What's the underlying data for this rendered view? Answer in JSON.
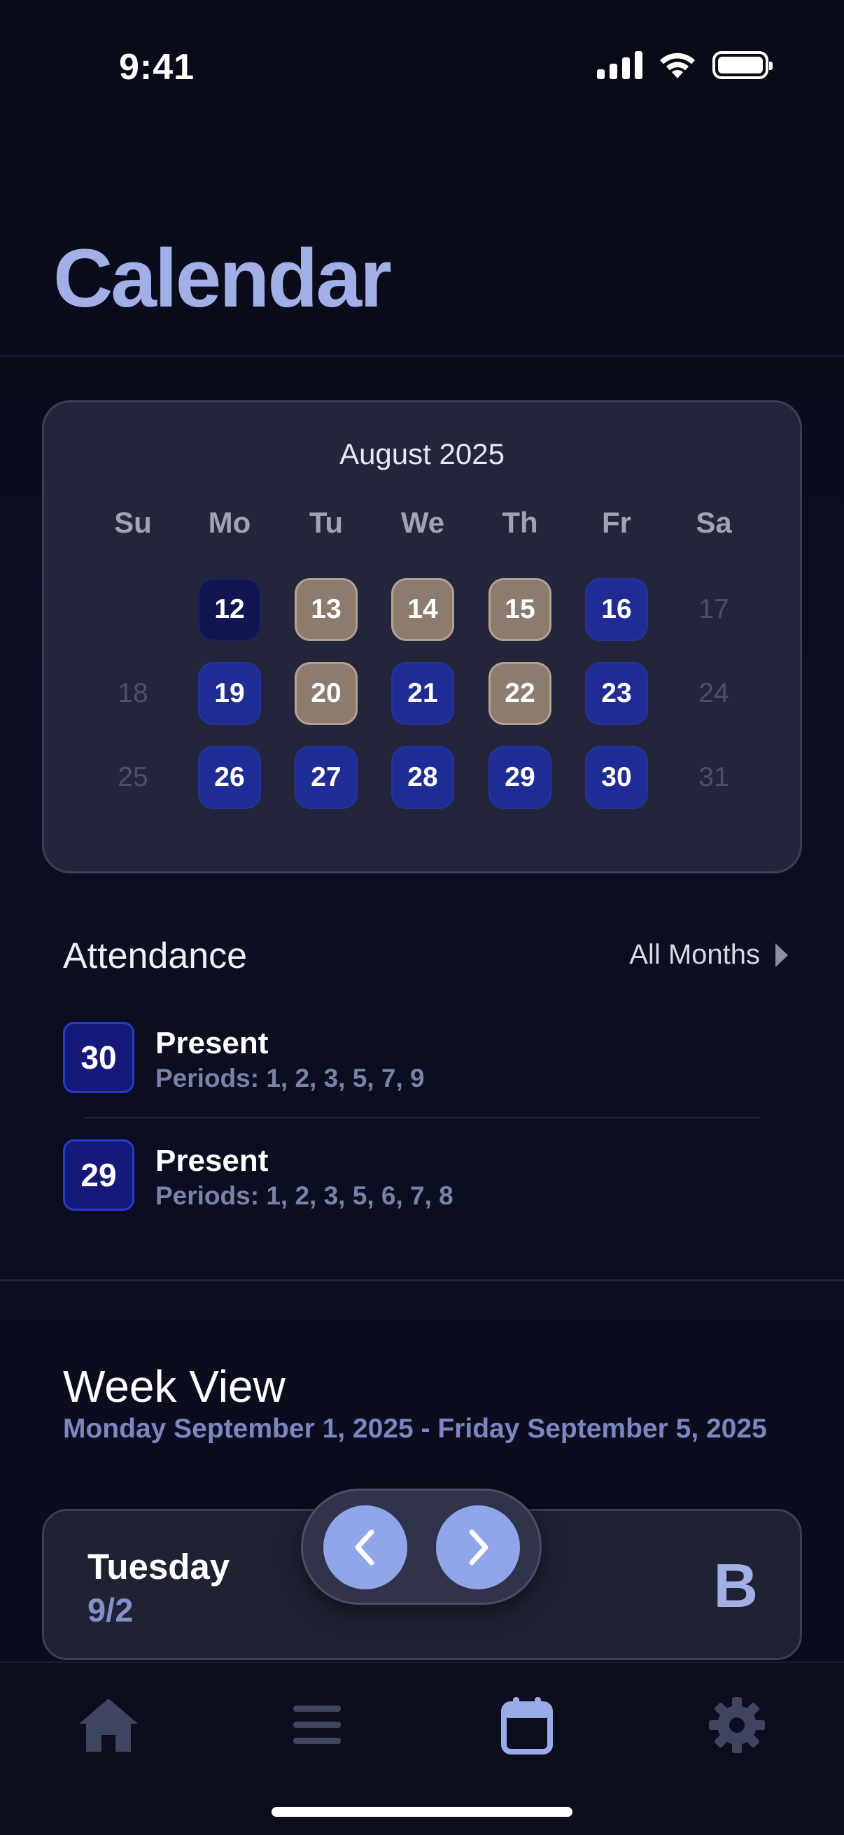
{
  "status_bar": {
    "time": "9:41",
    "icons": [
      "signal-icon",
      "wifi-icon",
      "battery-icon"
    ]
  },
  "page": {
    "title": "Calendar"
  },
  "calendar": {
    "month_label": "August 2025",
    "weekdays": [
      "Su",
      "Mo",
      "Tu",
      "We",
      "Th",
      "Fr",
      "Sa"
    ],
    "weeks": [
      [
        {
          "day": ""
        },
        {
          "day": "12",
          "state": "dark"
        },
        {
          "day": "13",
          "state": "tan"
        },
        {
          "day": "14",
          "state": "tan"
        },
        {
          "day": "15",
          "state": "tan"
        },
        {
          "day": "16",
          "state": "blue"
        },
        {
          "day": "17",
          "state": "muted"
        }
      ],
      [
        {
          "day": "18",
          "state": "muted"
        },
        {
          "day": "19",
          "state": "blue"
        },
        {
          "day": "20",
          "state": "tan"
        },
        {
          "day": "21",
          "state": "blue"
        },
        {
          "day": "22",
          "state": "tan"
        },
        {
          "day": "23",
          "state": "blue"
        },
        {
          "day": "24",
          "state": "muted"
        }
      ],
      [
        {
          "day": "25",
          "state": "muted"
        },
        {
          "day": "26",
          "state": "blue"
        },
        {
          "day": "27",
          "state": "blue"
        },
        {
          "day": "28",
          "state": "blue"
        },
        {
          "day": "29",
          "state": "blue"
        },
        {
          "day": "30",
          "state": "blue"
        },
        {
          "day": "31",
          "state": "muted"
        }
      ]
    ],
    "colors": {
      "dark": "#121650",
      "blue": "#1f2c96",
      "tan": "#8d7b6e",
      "muted": "#4c5066"
    }
  },
  "attendance": {
    "title": "Attendance",
    "all_months_label": "All Months",
    "records": [
      {
        "date": "30",
        "status": "Present",
        "periods": "Periods: 1, 2, 3, 5, 7, 9"
      },
      {
        "date": "29",
        "status": "Present",
        "periods": "Periods: 1, 2, 3, 5, 6, 7, 8"
      }
    ]
  },
  "week_view": {
    "title": "Week View",
    "range": "Monday September 1, 2025 - Friday September 5, 2025",
    "day": {
      "name": "Tuesday",
      "date": "9/2",
      "letter": "B"
    },
    "nav": {
      "prev_icon": "chevron-left-icon",
      "next_icon": "chevron-right-icon"
    }
  },
  "tab_bar": {
    "tabs": [
      {
        "id": "home",
        "icon": "home-icon",
        "active": false
      },
      {
        "id": "list",
        "icon": "list-icon",
        "active": false
      },
      {
        "id": "calendar",
        "icon": "calendar-icon",
        "active": true
      },
      {
        "id": "settings",
        "icon": "gear-icon",
        "active": false
      }
    ],
    "active_color": "#9aabea",
    "inactive_color": "#3f4460"
  }
}
